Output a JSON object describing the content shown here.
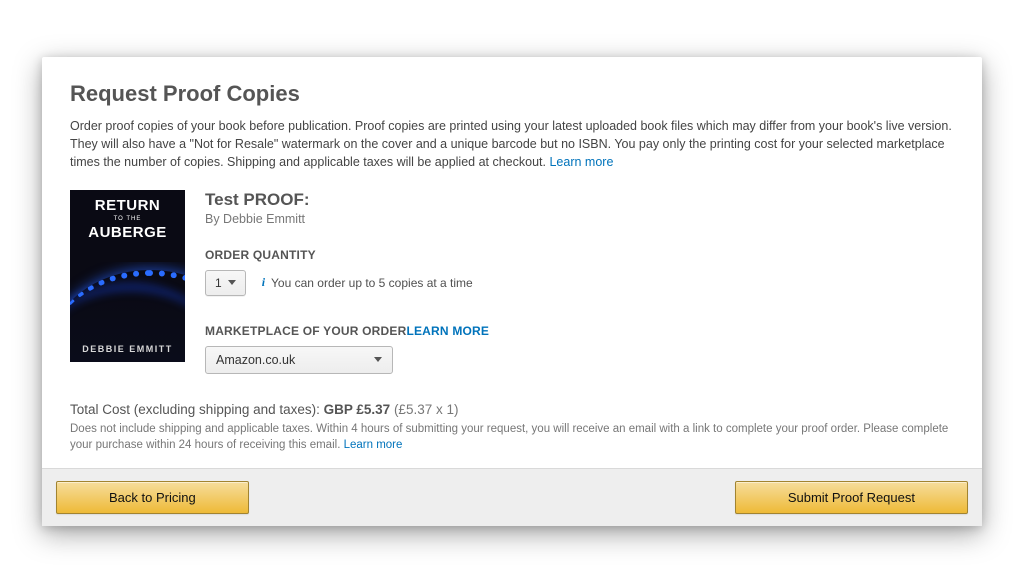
{
  "heading": "Request Proof Copies",
  "intro_text": "Order proof copies of your book before publication. Proof copies are printed using your latest uploaded book files which may differ from your book's live version. They will also have a \"Not for Resale\" watermark on the cover and a unique barcode but no ISBN. You pay only the printing cost for your selected marketplace times the number of copies. Shipping and applicable taxes will be applied at checkout. ",
  "intro_learn": "Learn more",
  "cover": {
    "line1": "RETURN",
    "line2": "TO THE",
    "line3": "AUBERGE",
    "author": "DEBBIE EMMITT"
  },
  "book": {
    "title_prefix": "Test ",
    "title_suffix": "PROOF:",
    "byline": "By Debbie Emmitt"
  },
  "qty": {
    "label": "ORDER QUANTITY",
    "value": "1",
    "hint": "You can order up to 5 copies at a time"
  },
  "mkt": {
    "label": "MARKETPLACE OF YOUR ORDER ",
    "learn": "LEARN MORE",
    "value": "Amazon.co.uk"
  },
  "totals": {
    "label_prefix": "Total Cost (excluding shipping and taxes): ",
    "amount": "GBP £5.37 ",
    "calc": "(£5.37 x 1)",
    "note": "Does not include shipping and applicable taxes. Within 4 hours of submitting your request, you will receive an email with a link to complete your proof order. Please complete your purchase within 24 hours of receiving this email. ",
    "note_learn": "Learn more"
  },
  "buttons": {
    "back": "Back to Pricing",
    "submit": "Submit Proof Request"
  }
}
